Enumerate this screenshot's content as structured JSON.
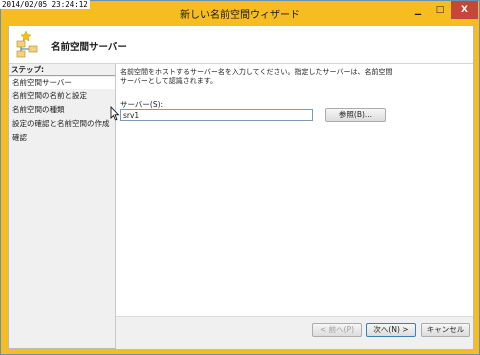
{
  "timestamp": "2014/02/05 23:24:12",
  "window": {
    "title": "新しい名前空間ウィザード",
    "minimize_glyph": "▁",
    "maximize_glyph": "□",
    "close_glyph": "X"
  },
  "header": {
    "title": "名前空間サーバー",
    "icon": "namespace-wizard-icon"
  },
  "sidebar": {
    "heading": "ステップ:",
    "steps": [
      {
        "label": "名前空間サーバー",
        "active": true
      },
      {
        "label": "名前空間の名前と設定",
        "active": false
      },
      {
        "label": "名前空間の種類",
        "active": false
      },
      {
        "label": "設定の確認と名前空間の作成",
        "active": false
      },
      {
        "label": "確認",
        "active": false
      }
    ]
  },
  "main": {
    "description_line1": "名前空間をホストするサーバー名を入力してください。指定したサーバーは、名前空間",
    "description_line2": "サーバーとして認識されます。",
    "server_label": "サーバー(S):",
    "server_value": "srv1",
    "browse_label": "参照(B)..."
  },
  "footer": {
    "prev_label": "< 前へ(P)",
    "next_label": "次へ(N) >",
    "cancel_label": "キャンセル"
  },
  "colors": {
    "titlebar": "#f6bd21",
    "close_button": "#c7463a",
    "active_step_bg": "#ffffff"
  }
}
